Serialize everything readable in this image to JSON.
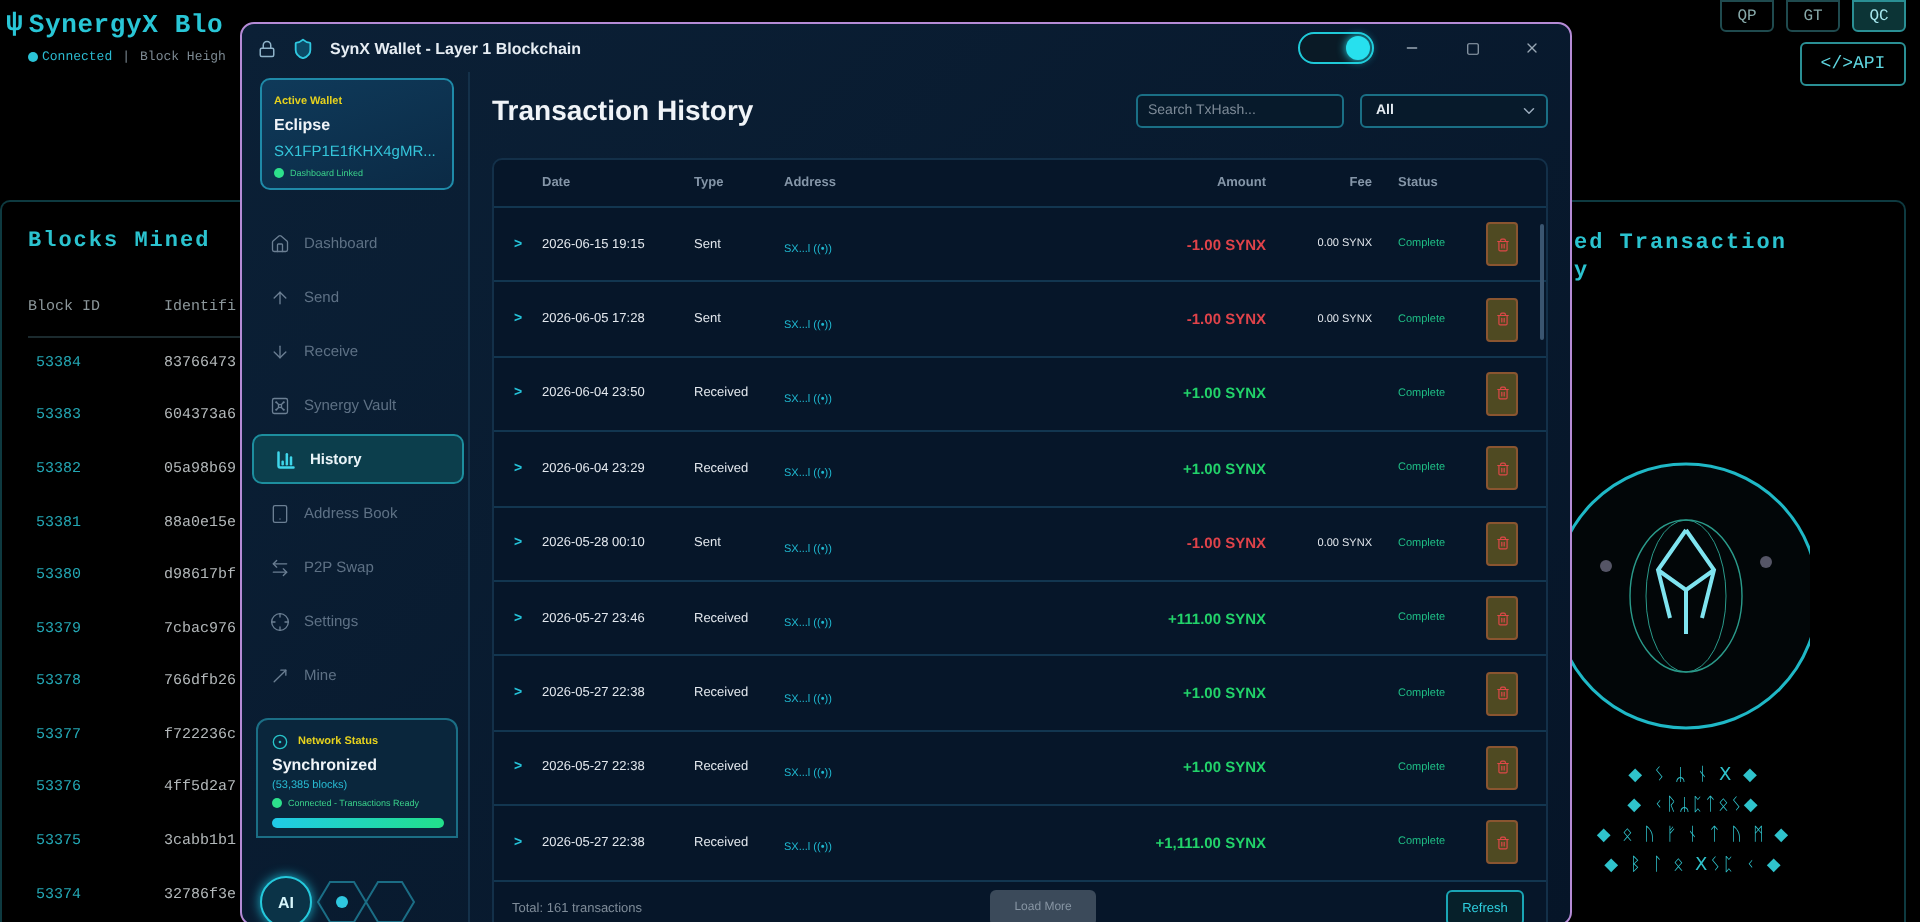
{
  "explorer": {
    "logo": "ψ",
    "title": "SynergyX Blo",
    "connection": "Connected",
    "separator": "|",
    "block_height_label": "Block Heigh",
    "top_buttons": [
      {
        "label": "QP",
        "selected": false
      },
      {
        "label": "GT",
        "selected": false
      },
      {
        "label": "QC",
        "selected": true
      }
    ],
    "api_button": "</>API",
    "blocks_panel": {
      "title": "Blocks Mined",
      "columns": [
        "Block ID",
        "Identifi"
      ],
      "rows": [
        [
          "53384",
          "83766473"
        ],
        [
          "53383",
          "604373a6"
        ],
        [
          "53382",
          "05a98b69"
        ],
        [
          "53381",
          "88a0e15e"
        ],
        [
          "53380",
          "d98617bf"
        ],
        [
          "53379",
          "7cbac976"
        ],
        [
          "53378",
          "766dfb26"
        ],
        [
          "53377",
          "f722236c"
        ],
        [
          "53376",
          "4ff5d2a7"
        ],
        [
          "53375",
          "3cabb1b1"
        ],
        [
          "53374",
          "32786f3e"
        ]
      ]
    },
    "side_panel": {
      "title_lines": [
        "ed Transaction",
        "y"
      ],
      "runes": [
        "◆ ᛊ ᛦ ᚾ X ◆",
        "◆ ᚲᚱᛦᛈᛏᛟᛊ◆",
        "◆ ᛟ ᚢ ᚠ ᚾ ᛏ ᚢ ᛗ ◆",
        "◆ ᛒ ᛚ ᛟ Xᛊᛈ ᚲ ◆"
      ]
    }
  },
  "window": {
    "title": "SynX Wallet - Layer 1 Blockchain",
    "theme_toggle_on": true,
    "sidebar": {
      "wallet": {
        "label": "Active Wallet",
        "name": "Eclipse",
        "address": "SX1FP1E1fKHX4gMR...",
        "status": "Dashboard Linked"
      },
      "items": [
        {
          "label": "Dashboard",
          "selected": false
        },
        {
          "label": "Send",
          "selected": false
        },
        {
          "label": "Receive",
          "selected": false
        },
        {
          "label": "Synergy Vault",
          "selected": false
        },
        {
          "label": "History",
          "selected": true
        },
        {
          "label": "Address Book",
          "selected": false
        },
        {
          "label": "P2P Swap",
          "selected": false
        },
        {
          "label": "Settings",
          "selected": false
        },
        {
          "label": "Mine",
          "selected": false
        }
      ],
      "network": {
        "label": "Network Status",
        "state": "Synchronized",
        "blocks": "(53,385 blocks)",
        "message": "Connected - Transactions Ready",
        "level": 1
      },
      "ai_button": "AI"
    },
    "main": {
      "title": "Transaction History",
      "search": {
        "placeholder": "Search TxHash..."
      },
      "filter": "All",
      "columns": [
        "Date",
        "Type",
        "Address",
        "Amount",
        "Fee",
        "Status"
      ],
      "rows": [
        {
          "expand": ">",
          "date": "2026-06-15 19:15",
          "type": "Sent",
          "address": "SX...l ((•))",
          "amount": "-1.00 SYNX",
          "kind": "debit",
          "fee": "0.00 SYNX",
          "status": "Complete"
        },
        {
          "expand": ">",
          "date": "2026-06-05 17:28",
          "type": "Sent",
          "address": "SX...l ((•))",
          "amount": "-1.00 SYNX",
          "kind": "debit",
          "fee": "0.00 SYNX",
          "status": "Complete"
        },
        {
          "expand": ">",
          "date": "2026-06-04 23:50",
          "type": "Received",
          "address": "SX...l ((•))",
          "amount": "+1.00 SYNX",
          "kind": "credit",
          "status": "Complete"
        },
        {
          "expand": ">",
          "date": "2026-06-04 23:29",
          "type": "Received",
          "address": "SX...l ((•))",
          "amount": "+1.00 SYNX",
          "kind": "credit",
          "status": "Complete"
        },
        {
          "expand": ">",
          "date": "2026-05-28 00:10",
          "type": "Sent",
          "address": "SX...l ((•))",
          "amount": "-1.00 SYNX",
          "kind": "debit",
          "fee": "0.00 SYNX",
          "status": "Complete"
        },
        {
          "expand": ">",
          "date": "2026-05-27 23:46",
          "type": "Received",
          "address": "SX...l ((•))",
          "amount": "+111.00 SYNX",
          "kind": "credit",
          "status": "Complete"
        },
        {
          "expand": ">",
          "date": "2026-05-27 22:38",
          "type": "Received",
          "address": "SX...l ((•))",
          "amount": "+1.00 SYNX",
          "kind": "credit",
          "status": "Complete"
        },
        {
          "expand": ">",
          "date": "2026-05-27 22:38",
          "type": "Received",
          "address": "SX...l ((•))",
          "amount": "+1.00 SYNX",
          "kind": "credit",
          "status": "Complete"
        },
        {
          "expand": ">",
          "date": "2026-05-27 22:38",
          "type": "Received",
          "address": "SX...l ((•))",
          "amount": "+1,111.00 SYNX",
          "kind": "credit",
          "status": "Complete"
        }
      ],
      "total": "Total: 161 transactions",
      "load_more": {
        "label": "Load More",
        "disabled": true
      },
      "refresh": "Refresh"
    }
  }
}
